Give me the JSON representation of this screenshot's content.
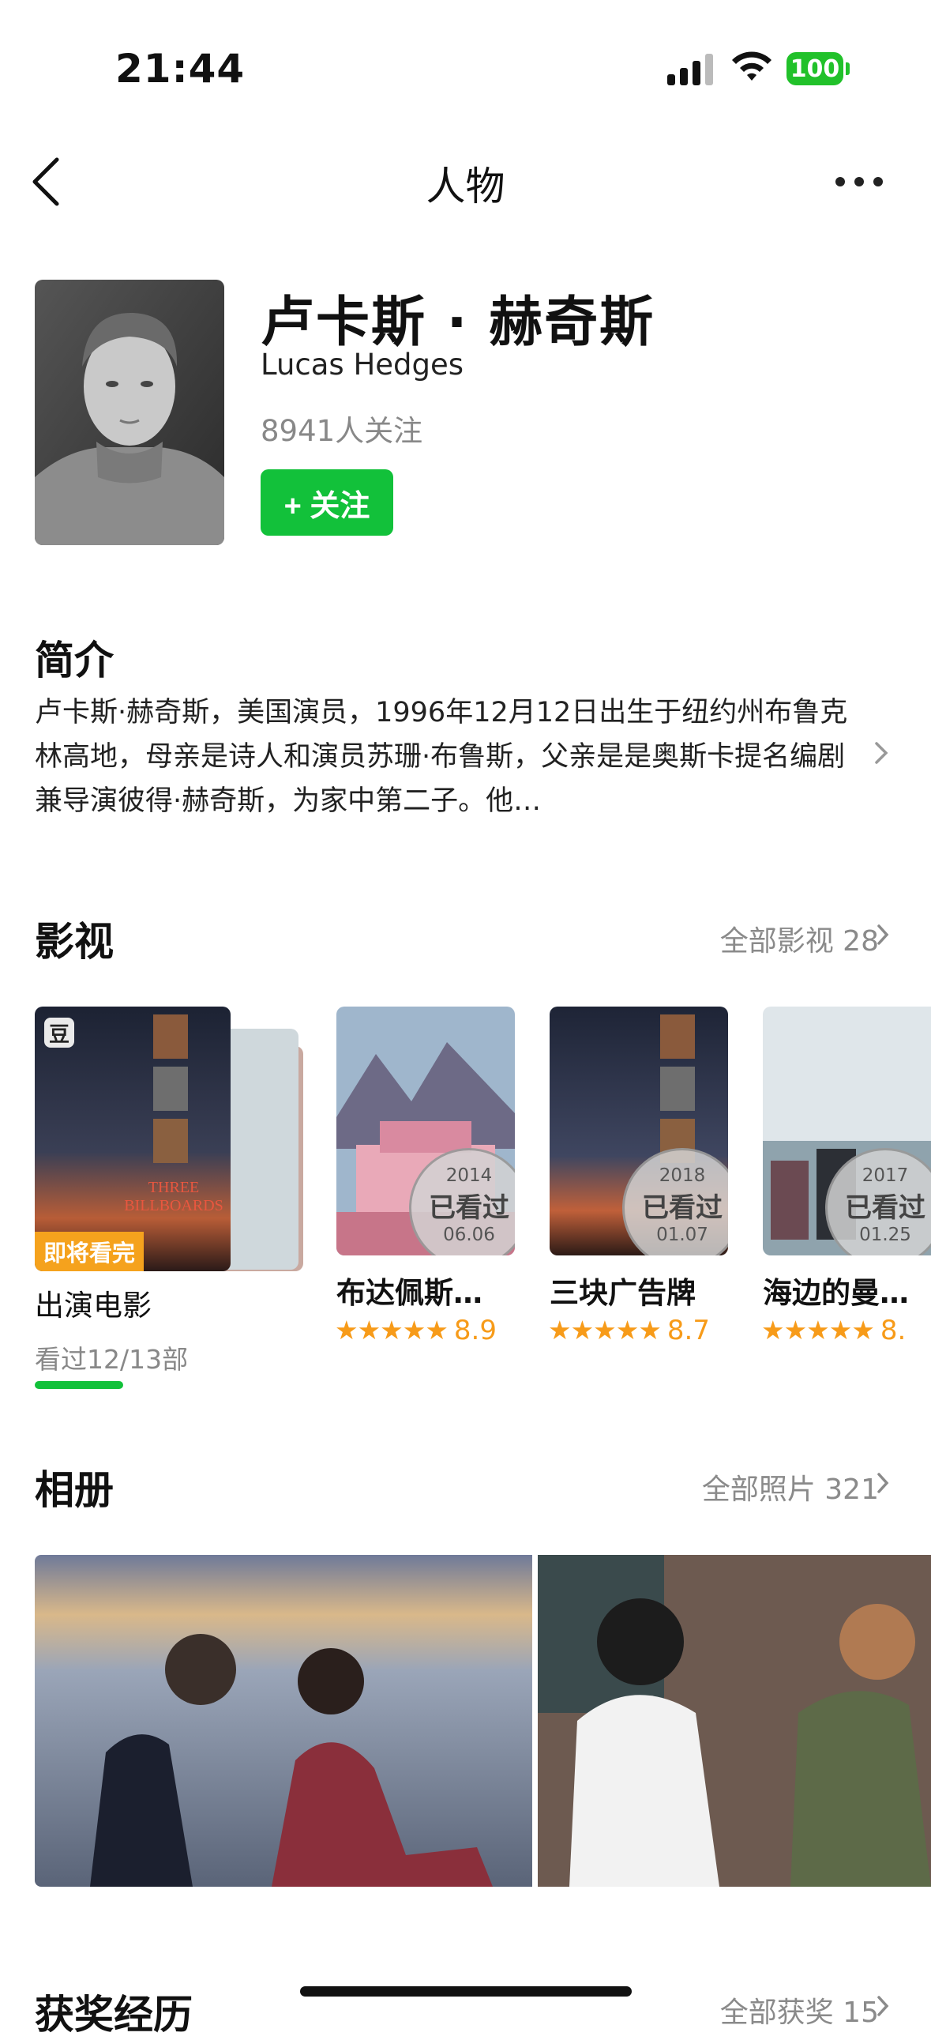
{
  "status_bar": {
    "time": "21:44",
    "battery": "100",
    "accent": "#21c12a"
  },
  "nav": {
    "title": "人物",
    "back_icon": "chevron-left-icon",
    "more_icon": "more-dots-icon"
  },
  "person": {
    "name_cn": "卢卡斯 · 赫奇斯",
    "name_en": "Lucas Hedges",
    "followers": "8941人关注",
    "follow_label": "+ 关注",
    "follow_color": "#12c13a"
  },
  "intro": {
    "title": "简介",
    "text": "卢卡斯·赫奇斯，美国演员，1996年12月12日出生于纽约州布鲁克林高地，母亲是诗人和演员苏珊·布鲁斯，父亲是是奥斯卡提名编剧兼导演彼得·赫奇斯，为家中第二子。他…"
  },
  "filmography": {
    "title": "影视",
    "all_label": "全部影视 28",
    "stack": {
      "badge": "豆",
      "upcoming": "即将看完",
      "label": "出演电影",
      "watched": "看过12/13部",
      "progress": 0.92
    },
    "movies": [
      {
        "title": "布达佩斯…",
        "stamp_year": "2014",
        "stamp_text": "已看过",
        "stamp_date": "06.06",
        "stars": "★★★★★",
        "score": "8.9"
      },
      {
        "title": "三块广告牌",
        "stamp_year": "2018",
        "stamp_text": "已看过",
        "stamp_date": "01.07",
        "stars": "★★★★★",
        "score": "8.7"
      },
      {
        "title": "海边的曼…",
        "stamp_year": "2017",
        "stamp_text": "已看过",
        "stamp_date": "01.25",
        "stars": "★★★★★",
        "score": "8."
      }
    ]
  },
  "album": {
    "title": "相册",
    "all_label": "全部照片 321"
  },
  "awards": {
    "title": "获奖经历",
    "all_label": "全部获奖 15"
  }
}
